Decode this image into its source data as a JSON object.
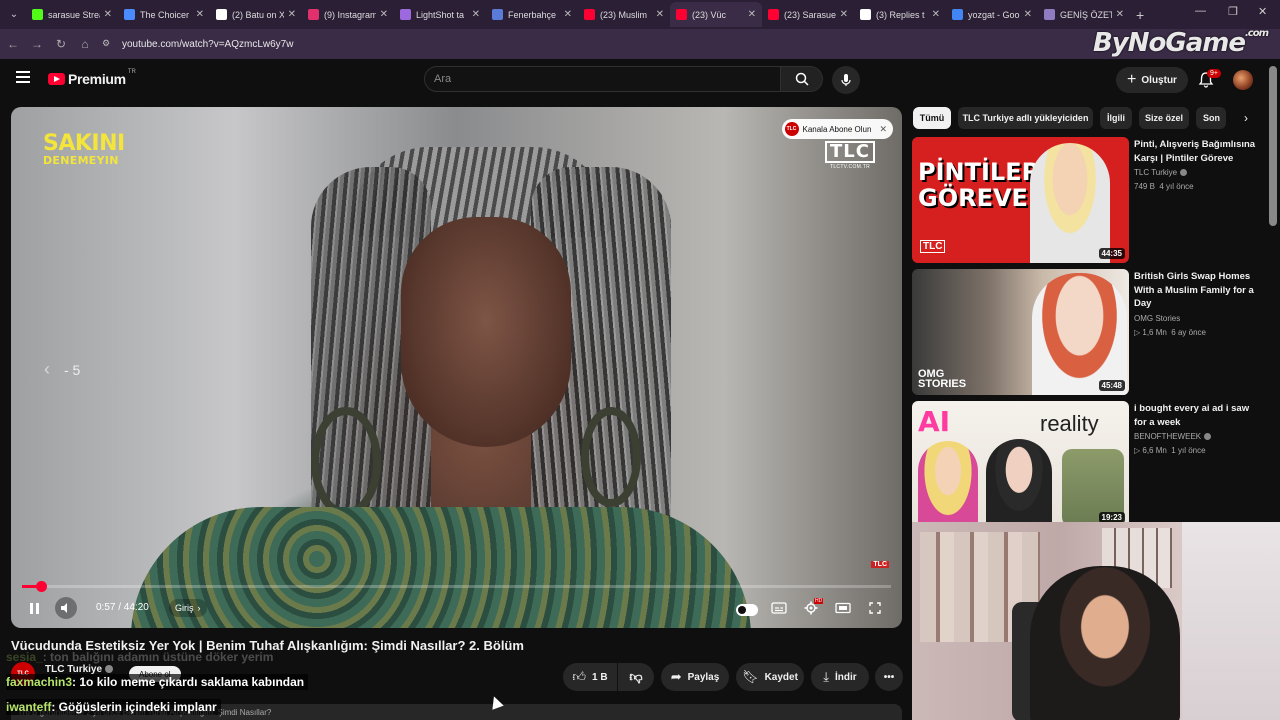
{
  "browser": {
    "tabs": [
      {
        "label": "sarasue Strea",
        "favicon_color": "#53fc18"
      },
      {
        "label": "The Choicer",
        "favicon_color": "#4a8cff"
      },
      {
        "label": "(2) Batu on X",
        "favicon_color": "#ffffff"
      },
      {
        "label": "(9) Instagram",
        "favicon_color": "#e1306c"
      },
      {
        "label": "LightShot ta",
        "favicon_color": "#9c6ade"
      },
      {
        "label": "Fenerbahçe",
        "favicon_color": "#5b7bd8"
      },
      {
        "label": "(23) Muslim",
        "favicon_color": "#ff0033"
      },
      {
        "label": "(23) Vüc",
        "favicon_color": "#ff0033",
        "active": true
      },
      {
        "label": "(23) Sarasue",
        "favicon_color": "#ff0033"
      },
      {
        "label": "(3) Replies t",
        "favicon_color": "#ffffff"
      },
      {
        "label": "yozgat - Goo",
        "favicon_color": "#4285f4"
      },
      {
        "label": "GENİŞ ÖZET",
        "favicon_color": "#8e7cc3"
      }
    ],
    "url": "youtube.com/watch?v=AQzmcLw6y7w",
    "watermark": {
      "main": "ByNoGame",
      "suffix": ".com"
    }
  },
  "header": {
    "logo_word": "Premium",
    "logo_region": "TR",
    "search_placeholder": "Ara",
    "create_label": "Oluştur",
    "notif_count": "9+"
  },
  "player": {
    "show_logo_big": "SAKINI",
    "show_logo_small": "DENEMEYIN",
    "tlc_word": "TLC",
    "tlc_url": "TLCTV.COM.TR",
    "subscribe_label": "Kanala Abone Olun",
    "subscribe_logo": "TLC",
    "tlc_corner": "TLC",
    "seek_hint": "- 5",
    "progress": 0.0216,
    "time_display": "0:57 / 44:20",
    "chapter_label": "Giriş"
  },
  "video": {
    "title": "Vücudunda Estetiksiz Yer Yok | Benim Tuhaf Alışkanlığım: Şimdi Nasıllar? 2. Bölüm",
    "channel_name": "TLC Turkiye",
    "channel_avatar": "TLC",
    "subscribe_label": "Abone ol",
    "description_preview": "I'r6 B görüntüleme  2 yıl önce  Benim Tuhaf Alışkanlığım: Şimdi Nasıllar?"
  },
  "actions": {
    "like_count": "1 B",
    "share": "Paylaş",
    "save": "Kaydet",
    "download": "İndir"
  },
  "chat": [
    {
      "user": "sesia_",
      "msg": ": ton balığını adamın üstüne döker yerim",
      "faded": true
    },
    {
      "user": "faxmachin3",
      "msg": ": 1o kilo meme çıkardı saklama kabından",
      "faded": false
    },
    {
      "user": "iwanteff",
      "msg": ": Göğüslerin içindeki implanr",
      "faded": false
    }
  ],
  "chips": [
    "Tümü",
    "TLC Turkiye adlı yükleyiciden",
    "İlgili",
    "Size özel",
    "Son"
  ],
  "recommendations": [
    {
      "title": "Pinti, Alışveriş Bağımlısına Karşı | Pintiler Göreve",
      "channel": "TLC Turkiye",
      "verified": true,
      "views": "749 B",
      "age": "4 yıl önce",
      "duration": "44:35",
      "thumb_text": "PİNTİLER\nGÖREVE",
      "thumb_logo": "TLC"
    },
    {
      "title": "British Girls Swap Homes With a Muslim Family for a Day",
      "channel": "OMG Stories",
      "verified": false,
      "views": "1,6 Mn",
      "age": "6 ay önce",
      "duration": "45:48",
      "thumb_text": "OMG\nSTORIES"
    },
    {
      "title": "i bought every ai ad i saw for a week",
      "channel": "BENOFTHEWEEK",
      "verified": true,
      "views": "6,6 Mn",
      "age": "1 yıl önce",
      "duration": "19:23",
      "thumb_text": "AI",
      "thumb_text2": "reality"
    }
  ],
  "colors": {
    "accent": "#ff0033",
    "background": "#0f0f0f",
    "chip_bg": "#272727",
    "chat_user": "#b6e36a"
  }
}
